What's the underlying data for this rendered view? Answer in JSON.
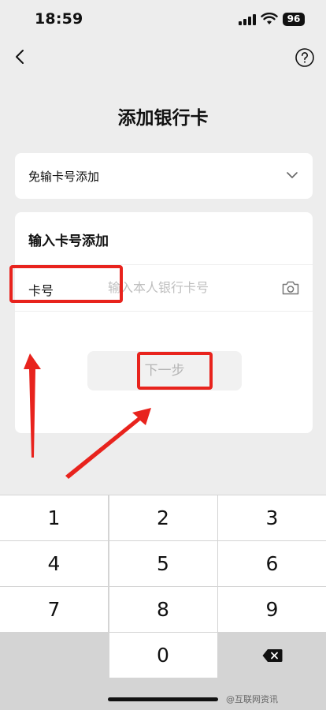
{
  "status_bar": {
    "time": "18:59",
    "battery": "96"
  },
  "header": {
    "title": "添加银行卡"
  },
  "quick_add": {
    "label": "免输卡号添加"
  },
  "manual_add": {
    "title": "输入卡号添加",
    "card_number_label": "卡号",
    "card_number_placeholder": "输入本人银行卡号",
    "next_button": "下一步"
  },
  "keypad": {
    "keys": [
      "1",
      "2",
      "3",
      "4",
      "5",
      "6",
      "7",
      "8",
      "9",
      "0"
    ]
  },
  "watermark": {
    "text": "@互联网资讯"
  },
  "colors": {
    "background": "#ededed",
    "annotation_red": "#e8231d",
    "button_disabled_text": "#b5b5b5"
  },
  "icons": {
    "back": "chevron-left-icon",
    "help": "question-circle-icon",
    "dropdown": "chevron-down-icon",
    "camera": "camera-icon",
    "delete": "backspace-icon"
  }
}
